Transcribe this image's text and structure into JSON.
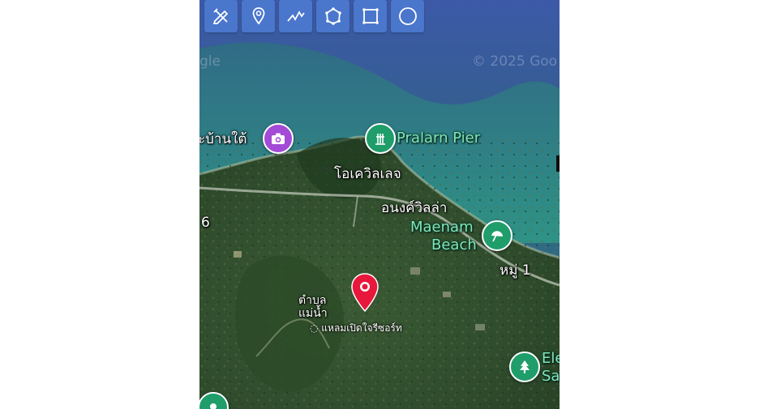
{
  "map": {
    "toolbar": [
      {
        "name": "edit-tool",
        "icon": "pencil-ruler-icon"
      },
      {
        "name": "marker-tool",
        "icon": "map-pin-icon"
      },
      {
        "name": "polyline-tool",
        "icon": "polyline-icon"
      },
      {
        "name": "polygon-tool",
        "icon": "polygon-icon"
      },
      {
        "name": "rectangle-tool",
        "icon": "rectangle-icon"
      },
      {
        "name": "circle-tool",
        "icon": "circle-icon"
      }
    ],
    "watermarks": {
      "left": "gle",
      "right": "© 2025 Goo"
    },
    "labels": {
      "beach_north": "ะบ้านใต้",
      "pralarn_pier": "Pralarn Pier",
      "village_1": "โอเควิลเลจ",
      "villa": "อนงค์วิลล่า",
      "maenam_beach_line1": "Maenam",
      "maenam_beach_line2": "Beach",
      "moo_1": "หมู่ 1",
      "road_6": "6",
      "tambon_line1": "ตำบล",
      "tambon_line2": "แม่น้ำ",
      "small_place": "แหลมเปิดใจรีซอร์ท",
      "ele_line1": "Ele",
      "ele_line2": "Sa"
    },
    "colors": {
      "toolbar": "#4a76cc",
      "marker": "#e8173c",
      "poi_camera": "#a34ad6",
      "poi_green": "#1f9d6b"
    }
  }
}
